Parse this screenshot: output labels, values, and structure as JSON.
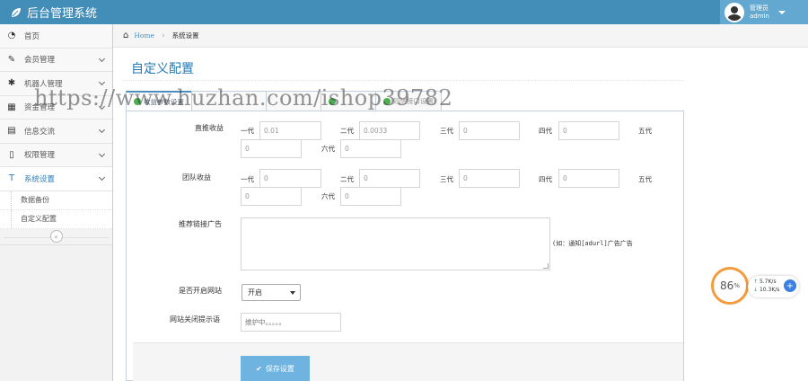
{
  "app": {
    "title": "后台管理系统"
  },
  "user": {
    "role": "管理员",
    "name": "admin"
  },
  "sidebar": {
    "items": [
      {
        "label": "首页",
        "icon": "dashboard-icon",
        "glyph": "◔"
      },
      {
        "label": "会员管理",
        "icon": "edit-icon",
        "glyph": "✎"
      },
      {
        "label": "机器人管理",
        "icon": "asterisk-icon",
        "glyph": "✱"
      },
      {
        "label": "资金管理",
        "icon": "calendar-icon",
        "glyph": "▦"
      },
      {
        "label": "信息交流",
        "icon": "list-icon",
        "glyph": "▤"
      },
      {
        "label": "权限管理",
        "icon": "file-icon",
        "glyph": "▯"
      },
      {
        "label": "系统设置",
        "icon": "text-icon",
        "glyph": "T"
      }
    ],
    "sub_items": [
      {
        "label": "数据备份"
      },
      {
        "label": "自定义配置"
      }
    ],
    "collapse_glyph": "«"
  },
  "breadcrumb": {
    "home": "Home",
    "current": "系统设置"
  },
  "page": {
    "title": "自定义配置"
  },
  "tabs": [
    {
      "label": "收益参数设置",
      "active": true
    },
    {
      "label": "",
      "active": false
    },
    {
      "label": "",
      "active": false
    },
    {
      "label": "",
      "active": false
    },
    {
      "label": "短信接口设置",
      "active": false
    }
  ],
  "form": {
    "direct": {
      "label": "直推收益",
      "gens": [
        {
          "label": "一代",
          "value": "0.01"
        },
        {
          "label": "二代",
          "value": "0.0033"
        },
        {
          "label": "三代",
          "value": "0"
        },
        {
          "label": "四代",
          "value": "0"
        },
        {
          "label": "五代",
          "value": "0"
        },
        {
          "label": "六代",
          "value": "0"
        }
      ]
    },
    "team": {
      "label": "团队收益",
      "gens": [
        {
          "label": "一代",
          "value": "0"
        },
        {
          "label": "二代",
          "value": "0"
        },
        {
          "label": "三代",
          "value": "0"
        },
        {
          "label": "四代",
          "value": "0"
        },
        {
          "label": "五代",
          "value": "0"
        },
        {
          "label": "六代",
          "value": "0"
        }
      ]
    },
    "ad": {
      "label": "推荐链接广告",
      "hint": "(如：通知[adurl]广告广告"
    },
    "site_open": {
      "label": "是否开启网站",
      "value": "开启"
    },
    "close_msg": {
      "label": "网站关闭提示语",
      "placeholder": "维护中。。。。。"
    },
    "save_label": "保存设置"
  },
  "watermark": "https://www.huzhan.com/ishop39782",
  "speed": {
    "percent": "86",
    "unit": "%",
    "up": "5.7K/s",
    "down": "10.3K/s"
  },
  "colors": {
    "topbar": "#438eb9",
    "accent": "#2679b5",
    "button": "#6fb3e0",
    "gauge": "#f39c3c"
  }
}
